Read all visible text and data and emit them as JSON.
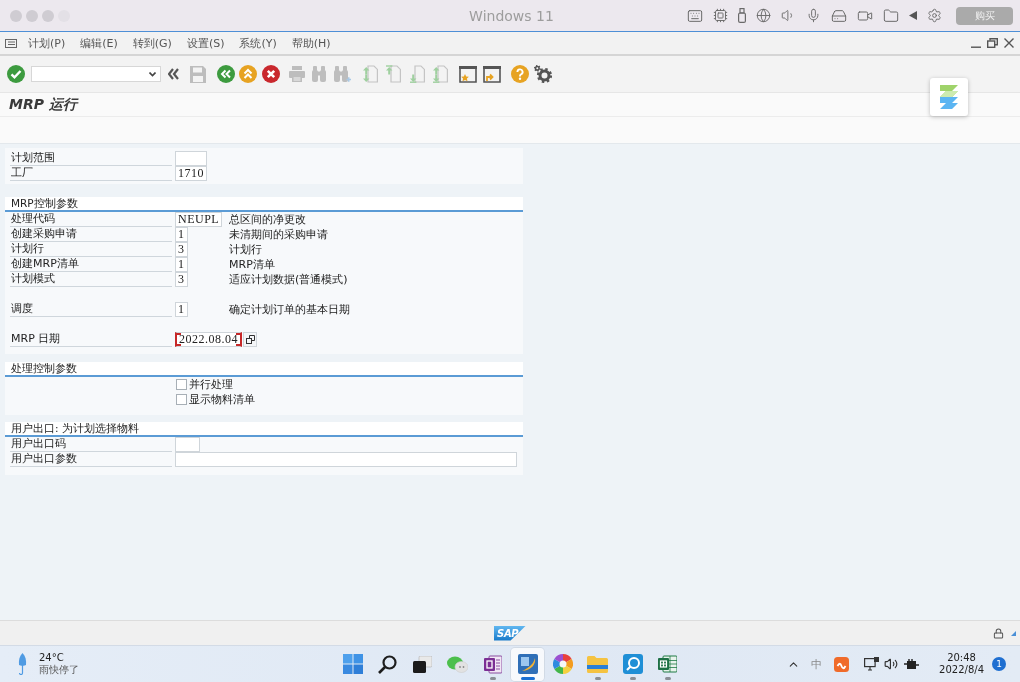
{
  "window": {
    "title": "Windows 11",
    "buy_button": "购买"
  },
  "menu": [
    "计划(P)",
    "编辑(E)",
    "转到(G)",
    "设置(S)",
    "系统(Y)",
    "帮助(H)"
  ],
  "toolbar": [
    {
      "kind": "enter",
      "disabled": false
    },
    {
      "kind": "command_field"
    },
    {
      "kind": "collapse",
      "disabled": false
    },
    {
      "kind": "save",
      "disabled": true
    },
    {
      "kind": "back",
      "disabled": false
    },
    {
      "kind": "exit",
      "disabled": false
    },
    {
      "kind": "cancel",
      "disabled": false
    },
    {
      "kind": "print",
      "disabled": true
    },
    {
      "kind": "find",
      "disabled": true
    },
    {
      "kind": "find_next",
      "disabled": true
    },
    {
      "kind": "first_page",
      "disabled": true
    },
    {
      "kind": "previous_page",
      "disabled": true
    },
    {
      "kind": "next_page",
      "disabled": true
    },
    {
      "kind": "last_page",
      "disabled": true
    },
    {
      "kind": "create_session",
      "disabled": false
    },
    {
      "kind": "shortcut",
      "disabled": false
    },
    {
      "kind": "help",
      "disabled": false
    },
    {
      "kind": "layout",
      "disabled": false
    }
  ],
  "screen_title": "MRP 运行",
  "selection": [
    {
      "label": "计划范围",
      "focused": false
    },
    {
      "label": "工厂",
      "value": "1710",
      "focused": false
    }
  ],
  "groups": [
    {
      "kind": "fields",
      "title": "MRP控制参数",
      "blocks": [
        [
          {
            "kind": "field",
            "label": "处理代码",
            "value": "NEUPL",
            "description": "总区间的净更改",
            "focused": false
          },
          {
            "kind": "field",
            "label": "创建采购申请",
            "value": "1",
            "description": "未清期间的采购申请",
            "focused": false
          },
          {
            "kind": "field",
            "label": "计划行",
            "value": "3",
            "description": "计划行",
            "focused": false
          },
          {
            "kind": "field",
            "label": "创建MRP清单",
            "value": "1",
            "description": "MRP清单",
            "focused": false
          },
          {
            "kind": "field",
            "label": "计划模式",
            "value": "3",
            "description": "适应计划数据(普通模式)",
            "focused": false
          }
        ],
        [
          {
            "kind": "field",
            "label": "调度",
            "value": "1",
            "description": "确定计划订单的基本日期",
            "focused": false
          }
        ],
        [
          {
            "kind": "date",
            "label": "MRP 日期",
            "value": "2022.08.04",
            "focused": true
          }
        ]
      ]
    },
    {
      "kind": "checkboxes",
      "title": "处理控制参数",
      "checkboxes": [
        {
          "label": "并行处理",
          "checked": false
        },
        {
          "label": "显示物料清单",
          "checked": false
        }
      ]
    },
    {
      "kind": "fields",
      "title": "用户出口: 为计划选择物料",
      "blocks": [
        [
          {
            "kind": "field",
            "label": "用户出口码",
            "focused": false
          },
          {
            "kind": "field",
            "label": "用户出口参数",
            "focused": false
          }
        ]
      ]
    }
  ],
  "status_bar": {
    "logo": "SAP"
  },
  "taskbar": {
    "weather": {
      "temperature": "24°C",
      "condition": "雨快停了"
    },
    "apps": [
      {
        "kind": "start",
        "selected": false,
        "running": false
      },
      {
        "kind": "search",
        "selected": false,
        "running": false
      },
      {
        "kind": "task_view",
        "selected": false,
        "running": false
      },
      {
        "kind": "chat",
        "selected": false,
        "running": false
      },
      {
        "kind": "notebook",
        "selected": false,
        "running": true
      },
      {
        "kind": "sap_logon",
        "selected": true,
        "running": true
      },
      {
        "kind": "color_wheel",
        "selected": false,
        "running": false
      },
      {
        "kind": "folder",
        "selected": false,
        "running": true
      },
      {
        "kind": "magnifier",
        "selected": false,
        "running": true
      },
      {
        "kind": "spreadsheet",
        "selected": false,
        "running": true
      }
    ],
    "input_method": "中",
    "time": "20:48",
    "date": "2022/8/4",
    "notifications": "1"
  }
}
